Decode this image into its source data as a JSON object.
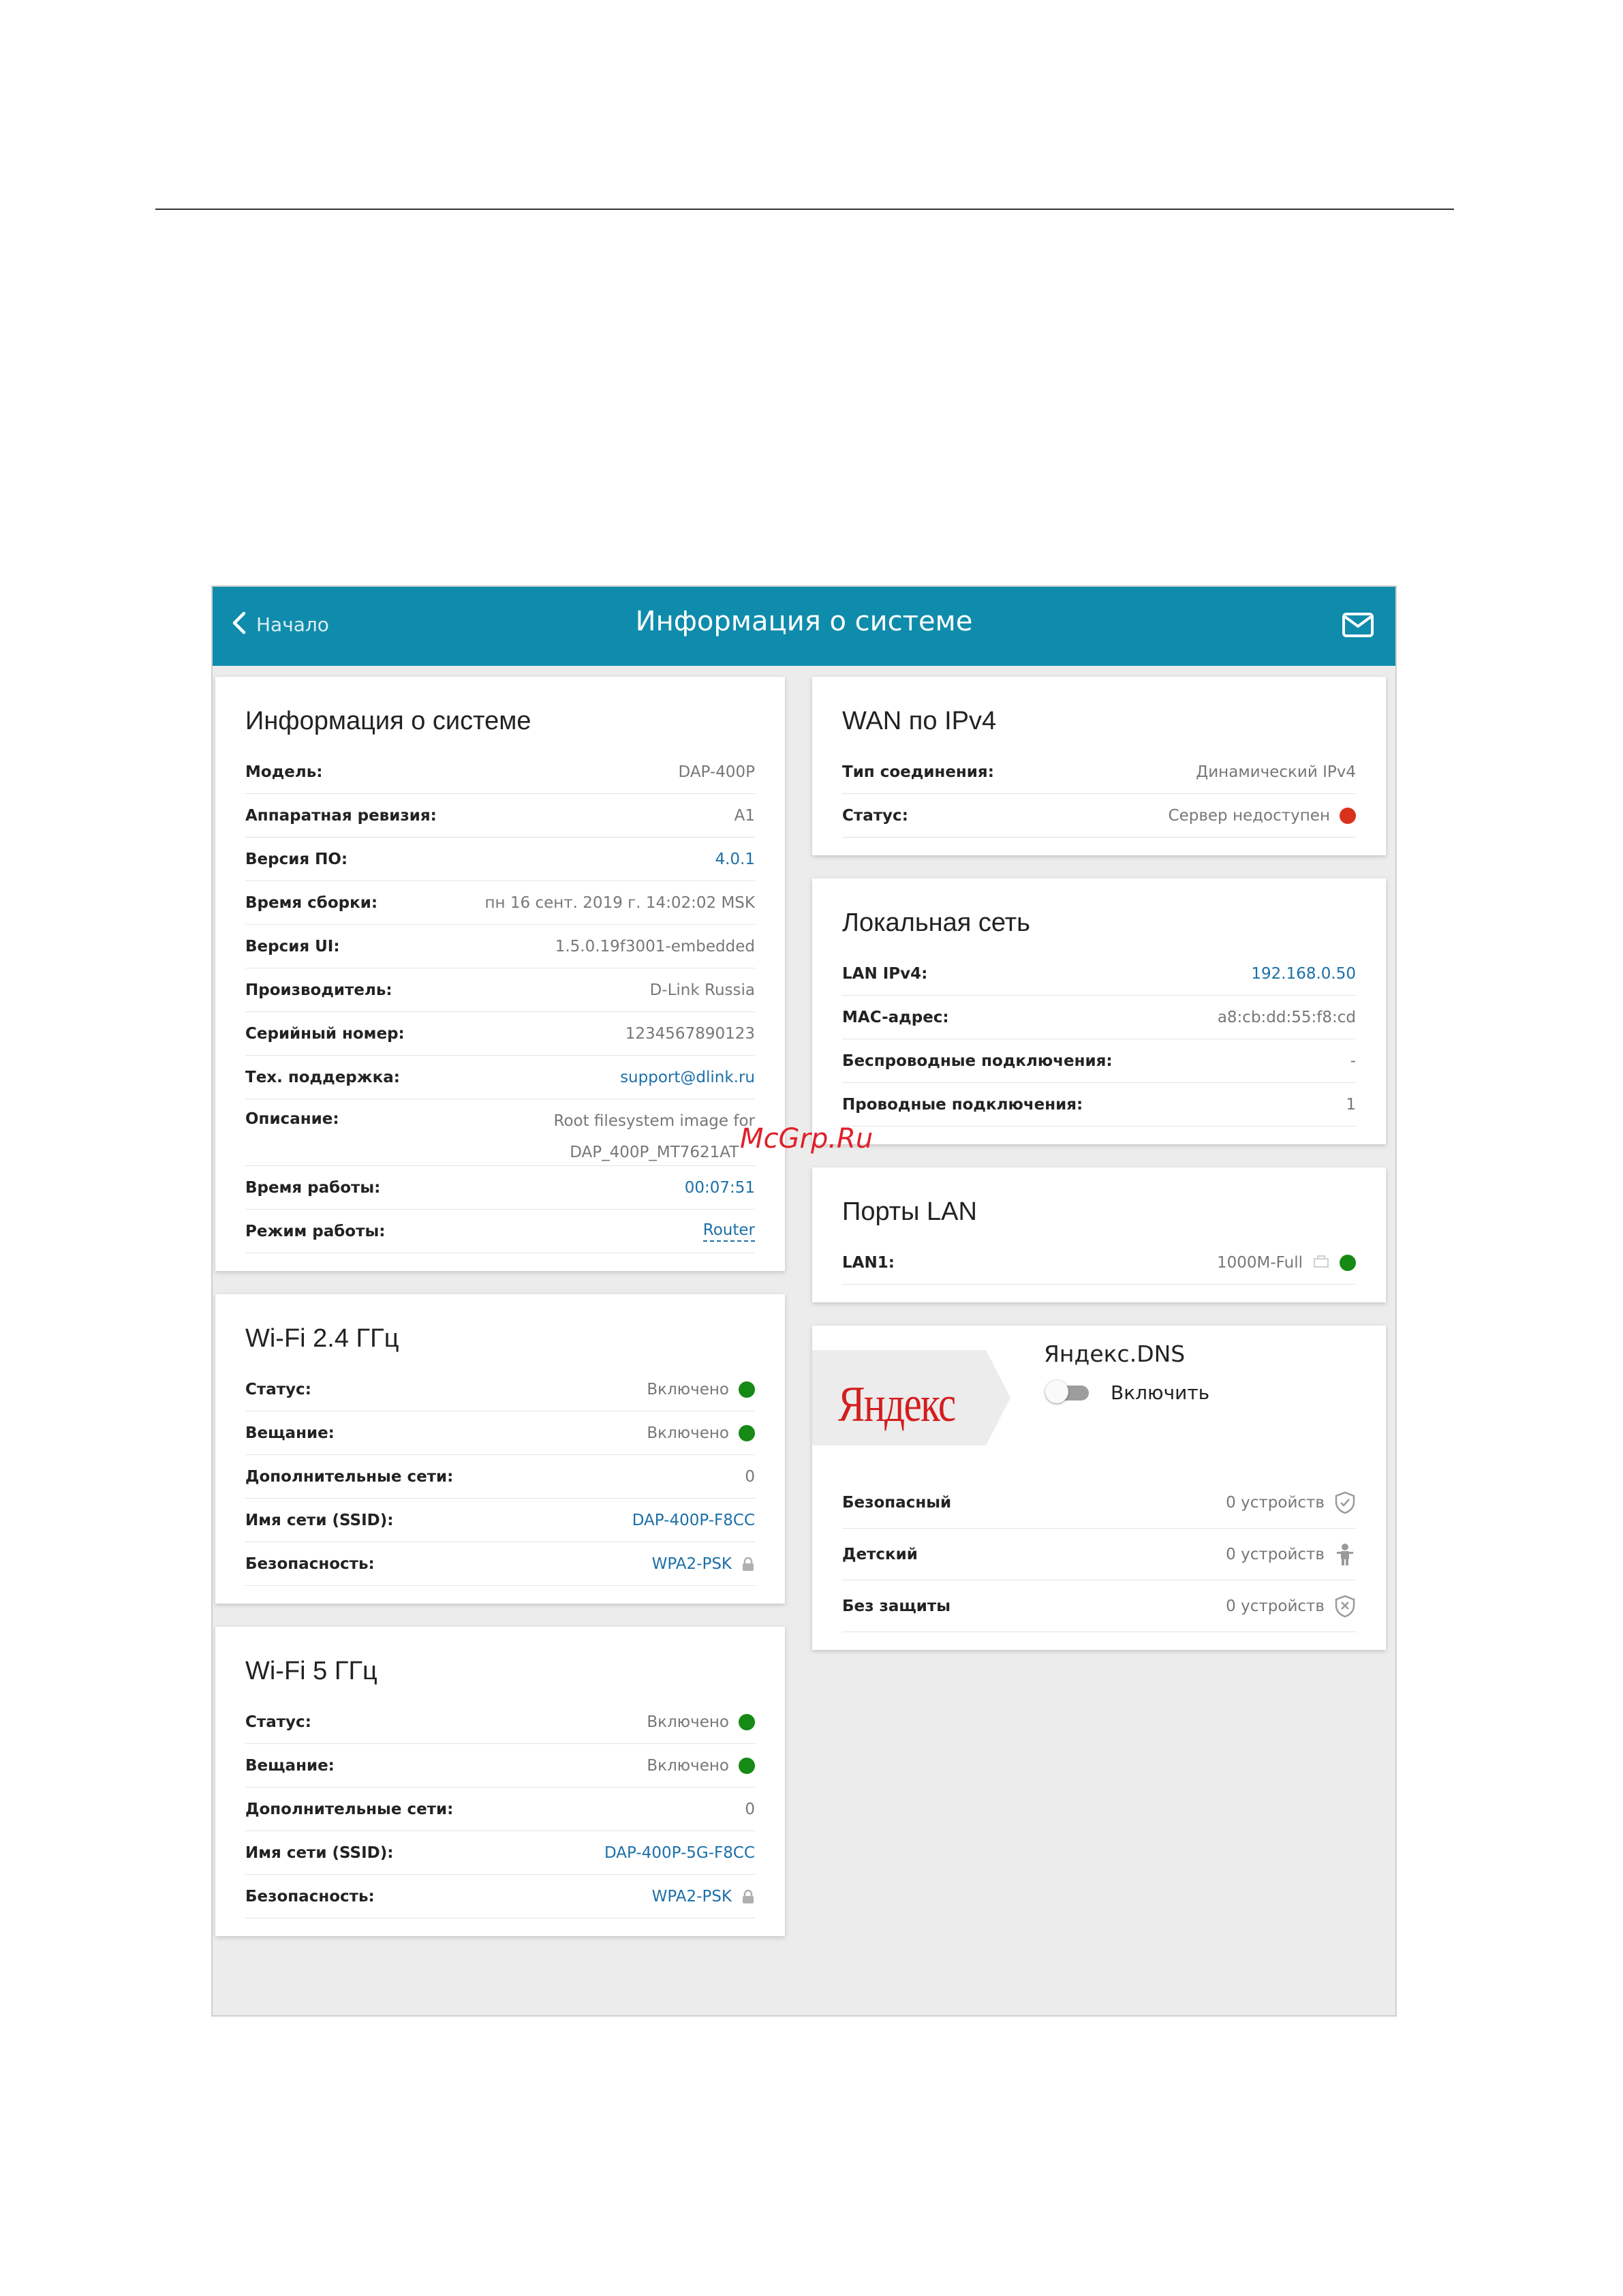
{
  "header": {
    "back_label": "Начало",
    "title": "Информация о системе",
    "brand_color": "#0f8cac"
  },
  "system": {
    "title": "Информация о системе",
    "rows": [
      {
        "label": "Модель:",
        "value": "DAP-400P"
      },
      {
        "label": "Аппаратная ревизия:",
        "value": "A1"
      },
      {
        "label": "Версия ПО:",
        "value": "4.0.1"
      },
      {
        "label": "Время сборки:",
        "value": "пн 16 сент. 2019 г. 14:02:02 MSK"
      },
      {
        "label": "Версия UI:",
        "value": "1.5.0.19f3001-embedded"
      },
      {
        "label": "Производитель:",
        "value": "D-Link Russia"
      },
      {
        "label": "Серийный номер:",
        "value": "1234567890123"
      },
      {
        "label": "Тех. поддержка:",
        "value": "support@dlink.ru"
      },
      {
        "label": "Описание:",
        "value_line1": "Root filesystem image for",
        "value_line2": "DAP_400P_MT7621AT"
      },
      {
        "label": "Время работы:",
        "value": "00:07:51"
      },
      {
        "label": "Режим работы:",
        "value": "Router"
      }
    ]
  },
  "wifi24": {
    "title": "Wi-Fi 2.4 ГГц",
    "rows": [
      {
        "label": "Статус:",
        "value": "Включено"
      },
      {
        "label": "Вещание:",
        "value": "Включено"
      },
      {
        "label": "Дополнительные сети:",
        "value": "0"
      },
      {
        "label": "Имя сети (SSID):",
        "value": "DAP-400P-F8CC"
      },
      {
        "label": "Безопасность:",
        "value": "WPA2-PSK"
      }
    ]
  },
  "wifi5": {
    "title": "Wi-Fi 5 ГГц",
    "rows": [
      {
        "label": "Статус:",
        "value": "Включено"
      },
      {
        "label": "Вещание:",
        "value": "Включено"
      },
      {
        "label": "Дополнительные сети:",
        "value": "0"
      },
      {
        "label": "Имя сети (SSID):",
        "value": "DAP-400P-5G-F8CC"
      },
      {
        "label": "Безопасность:",
        "value": "WPA2-PSK"
      }
    ]
  },
  "wan": {
    "title": "WAN по IPv4",
    "rows": [
      {
        "label": "Тип соединения:",
        "value": "Динамический IPv4"
      },
      {
        "label": "Статус:",
        "value": "Сервер недоступен"
      }
    ]
  },
  "lan": {
    "title": "Локальная сеть",
    "rows": [
      {
        "label": "LAN IPv4:",
        "value": "192.168.0.50"
      },
      {
        "label": "MAC-адрес:",
        "value": "a8:cb:dd:55:f8:cd"
      },
      {
        "label": "Беспроводные подключения:",
        "value": "-"
      },
      {
        "label": "Проводные подключения:",
        "value": "1"
      }
    ]
  },
  "ports": {
    "title": "Порты LAN",
    "rows": [
      {
        "label": "LAN1:",
        "value": "1000M-Full"
      }
    ]
  },
  "yandex": {
    "logo_text": "Яндекс",
    "name": "Яндекс.DNS",
    "toggle_label": "Включить",
    "toggle_on": false,
    "rows": [
      {
        "label": "Безопасный",
        "value": "0 устройств",
        "icon": "shield-check-icon"
      },
      {
        "label": "Детский",
        "value": "0 устройств",
        "icon": "child-icon"
      },
      {
        "label": "Без защиты",
        "value": "0 устройств",
        "icon": "shield-x-icon"
      }
    ]
  },
  "watermark": "McGrp.Ru",
  "status_colors": {
    "ok": "#158a15",
    "error": "#d9321b",
    "link": "#1c6fa8"
  }
}
